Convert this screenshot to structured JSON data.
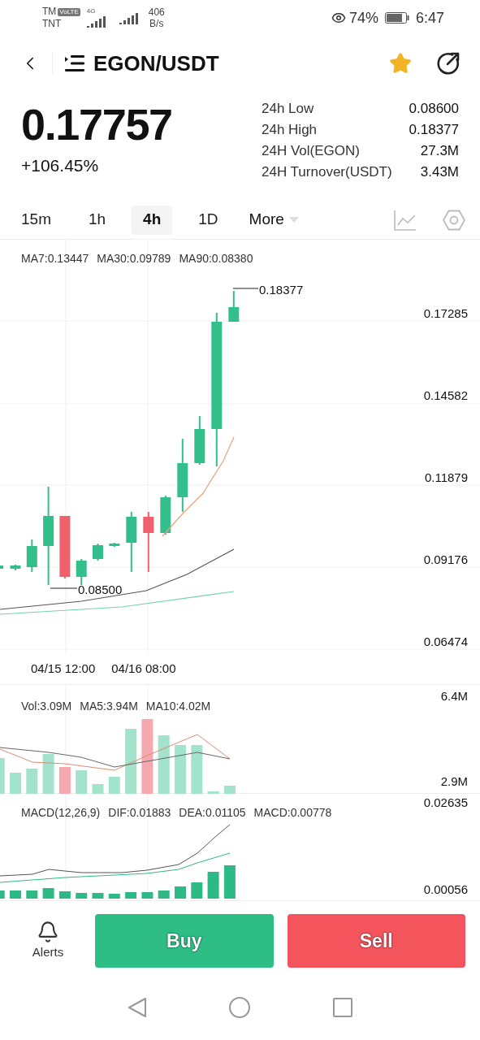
{
  "status_bar": {
    "carrier_1": "TM",
    "volte": "VoLTE",
    "network": "4G",
    "carrier_2": "TNT",
    "speed_value": "406",
    "speed_unit": "B/s",
    "battery": "74%",
    "time": "6:47"
  },
  "header": {
    "pair": "EGON/USDT",
    "favorite": true
  },
  "ticker": {
    "price": "0.17757",
    "change": "+106.45%",
    "stats": [
      {
        "label": "24h Low",
        "value": "0.08600"
      },
      {
        "label": "24h High",
        "value": "0.18377"
      },
      {
        "label": "24H Vol(EGON)",
        "value": "27.3M"
      },
      {
        "label": "24H Turnover(USDT)",
        "value": "3.43M"
      }
    ]
  },
  "intervals": [
    {
      "label": "15m",
      "selected": false
    },
    {
      "label": "1h",
      "selected": false
    },
    {
      "label": "4h",
      "selected": true
    },
    {
      "label": "1D",
      "selected": false
    }
  ],
  "more": "More",
  "price_chart": {
    "ma_legend": [
      "MA7:0.13447",
      "MA30:0.09789",
      "MA90:0.08380"
    ],
    "high_marker": "0.18377",
    "low_marker": "0.08500",
    "y_labels": [
      "0.17285",
      "0.14582",
      "0.11879",
      "0.09176",
      "0.06474"
    ],
    "x_labels": [
      "04/15 12:00",
      "04/16 08:00"
    ]
  },
  "volume": {
    "legend": [
      "Vol:3.09M",
      "MA5:3.94M",
      "MA10:4.02M"
    ],
    "y_labels": [
      "6.4M",
      "2.9M"
    ]
  },
  "macd": {
    "legend": [
      "MACD(12,26,9)",
      "DIF:0.01883",
      "DEA:0.01105",
      "MACD:0.00778"
    ],
    "y_labels": [
      "0.02635",
      "0.00056"
    ]
  },
  "actions": {
    "alerts": "Alerts",
    "buy": "Buy",
    "sell": "Sell"
  }
}
